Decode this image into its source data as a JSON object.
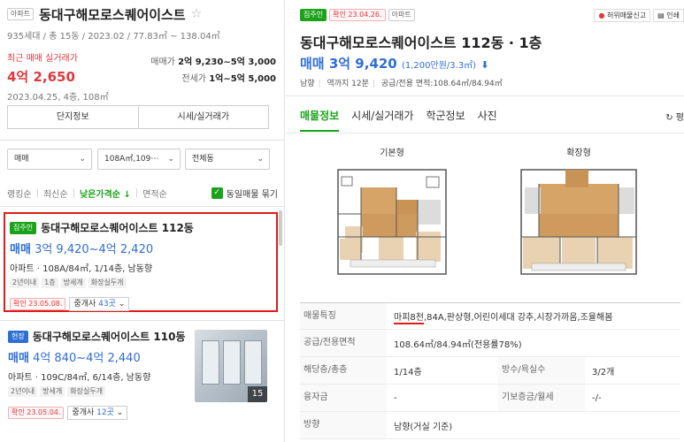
{
  "left": {
    "badge": "아파트",
    "title": "동대구해모로스퀘어이스트",
    "meta": "935세대 / 총 15동 / 2023.02 / 77.83㎡ ~ 138.04㎡",
    "recent_label": "최근 매매 실거래가",
    "recent_price": "4억 2,650",
    "recent_date": "2023.04.25, 4층, 108㎡",
    "sale_label": "매매가",
    "sale_range": "2억 9,230~5억 3,000",
    "jeonse_label": "전세가",
    "jeonse_range": "1억~5억 5,000",
    "btn_info": "단지정보",
    "btn_price": "시세/실거래가",
    "filter_type": "매매",
    "filter_area": "108A㎡,109⋯",
    "filter_dong": "전체동",
    "sort_ranking": "랭킹순",
    "sort_latest": "최신순",
    "sort_lowprice": "낮은가격순",
    "sort_area": "면적순",
    "group_label": "동일매물 묶기",
    "listings": [
      {
        "badge": "집주인",
        "title": "동대구해모로스퀘어이스트 112동",
        "price_kind": "매매",
        "price": "3억 9,420~4억 2,420",
        "spec": "아파트 · 108A/84㎡, 1/14층, 남동향",
        "tags": [
          "2년이내",
          "1층",
          "방세개",
          "화장실두개"
        ],
        "confirm": "확인 23.05.08.",
        "agent_label": "중개사",
        "agent_count": "43곳"
      },
      {
        "badge": "현장",
        "title": "동대구해모로스퀘어이스트 110동",
        "price_kind": "매매",
        "price": "4억 840~4억 2,440",
        "spec": "아파트 · 109C/84㎡, 6/14층, 남동향",
        "tags": [
          "2년이내",
          "방세개",
          "화장실두개"
        ],
        "confirm": "확인 23.05.04.",
        "agent_label": "중개사",
        "agent_count": "12곳",
        "photo_count": "15"
      }
    ]
  },
  "right": {
    "tag_owner": "집주인",
    "tag_confirm": "확인 23.04.26.",
    "tag_type": "아파트",
    "report_label": "허위매물신고",
    "print_label": "인쇄",
    "title": "동대구해모로스퀘어이스트 112동 · 1층",
    "price_kind": "매매",
    "price": "3억 9,420",
    "price_per": "(1,200만원/3.3㎡)",
    "info_dir": "남향",
    "info_station": "역까지 12분",
    "info_area": "공급/전용 면적:108.64㎡/84.94㎡",
    "tabs": [
      "매물정보",
      "시세/실거래가",
      "학군정보",
      "사진"
    ],
    "refresh_label": "평",
    "plan_basic": "기본형",
    "plan_extended": "확장형",
    "rows": [
      {
        "label": "매물특징",
        "value_hl": "마피8천",
        "value": ",84A,판상형,어린이세대 강추,시장가까움,조율해봄"
      },
      {
        "label": "공급/전용면적",
        "value": "108.64㎡/84.94㎡(전용률78%)"
      },
      {
        "label": "해당층/총층",
        "value": "1/14층",
        "label2": "방수/욕실수",
        "value2": "3/2개"
      },
      {
        "label": "융자금",
        "value": "-",
        "label2": "기보증금/월세",
        "value2": "-/-"
      },
      {
        "label": "방향",
        "value": "남향(거실 기준)"
      }
    ]
  },
  "colors": {
    "accent_green": "#1aa31a",
    "price_blue": "#2f6ed3",
    "price_red": "#e0383e",
    "highlight_red": "#e21a1a"
  }
}
